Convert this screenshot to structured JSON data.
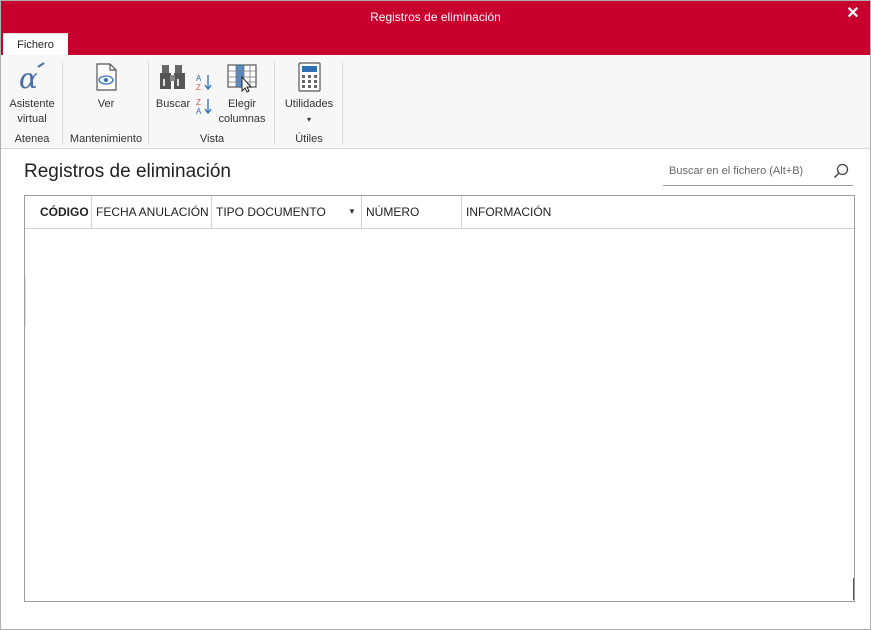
{
  "window": {
    "title": "Registros de eliminación",
    "close_glyph": "✕"
  },
  "tabs": [
    {
      "label": "Fichero"
    }
  ],
  "ribbon": {
    "groups": [
      {
        "label": "Atenea",
        "buttons": [
          {
            "label_line1": "Asistente",
            "label_line2": "virtual",
            "icon": "alpha-icon"
          }
        ]
      },
      {
        "label": "Mantenimiento",
        "buttons": [
          {
            "label_line1": "Ver",
            "icon": "view-document-icon"
          }
        ]
      },
      {
        "label": "Vista",
        "buttons": [
          {
            "label_line1": "Buscar",
            "icon": "binoculars-icon"
          },
          {
            "icon": "sort-ascending-icon"
          },
          {
            "icon": "sort-descending-icon"
          },
          {
            "label_line1": "Elegir",
            "label_line2": "columnas",
            "icon": "choose-columns-icon"
          }
        ]
      },
      {
        "label": "Útiles",
        "buttons": [
          {
            "label_line1": "Utilidades",
            "icon": "calculator-icon",
            "dropdown": "▾"
          }
        ]
      }
    ]
  },
  "main": {
    "title": "Registros de eliminación",
    "search": {
      "placeholder": "Buscar en el fichero (Alt+B)"
    }
  },
  "table": {
    "columns": [
      {
        "label": "CÓDIGO"
      },
      {
        "label": "FECHA ANULACIÓN"
      },
      {
        "label": "TIPO DOCUMENTO",
        "filter_glyph": "▼"
      },
      {
        "label": "NÚMERO"
      },
      {
        "label": "INFORMACIÓN"
      }
    ],
    "rows": []
  },
  "colors": {
    "accent": "#c8002e",
    "ribbon_bg": "#f7f7f7",
    "border": "#9e9e9e"
  }
}
